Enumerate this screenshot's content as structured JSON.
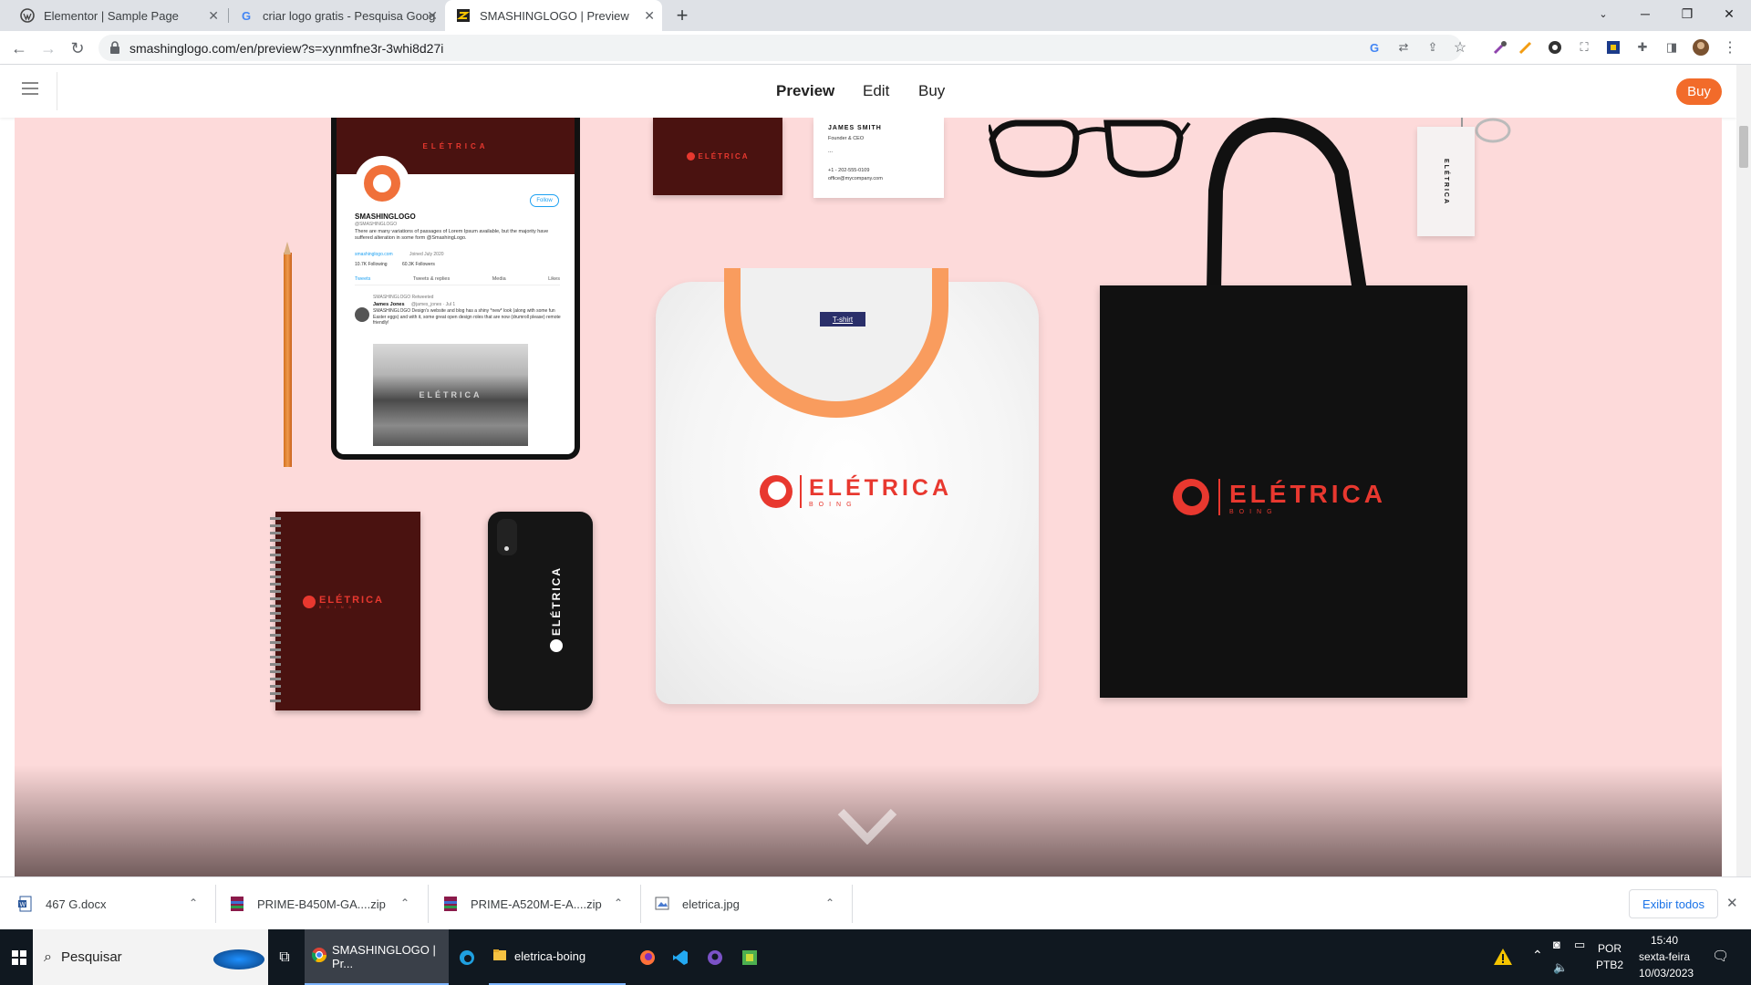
{
  "browser": {
    "tabs": [
      {
        "title": "Elementor | Sample Page",
        "active": false
      },
      {
        "title": "criar logo gratis - Pesquisa Goog",
        "active": false
      },
      {
        "title": "SMASHINGLOGO | Preview",
        "active": true
      }
    ],
    "new_tab": "+",
    "url": "smashinglogo.com/en/preview?s=xynmfne3r-3whi8d27i"
  },
  "site": {
    "nav": {
      "preview": "Preview",
      "edit": "Edit",
      "buy": "Buy"
    },
    "buy_button": "Buy"
  },
  "mockup": {
    "brand": "ELÉTRICA",
    "sub": "BOING",
    "tablet": {
      "account": "SMASHINGLOGO",
      "handle": "@SMASHINGLOGO",
      "follow": "Follow",
      "bio": "There are many variations of passages of Lorem Ipsum available, but the majority have suffered alteration in some form @SmashingLogo.",
      "link": "smashinglogo.com",
      "joined": "Joined July 2020",
      "following": "10.7K Following",
      "followers": "60.3K Followers",
      "tabs": [
        "Tweets",
        "Tweets & replies",
        "Media",
        "Likes"
      ],
      "retweet_label": "SMASHINGLOGO Retweeted",
      "tweet_author": "James Jones",
      "tweet_handle": "@james_jones · Jul 1",
      "tweet_text": "SMASHINGLOGO Design's website and blog has a shiny *new* look (along with some fun Easter eggs) and with it, some great open design roles that are now (drumroll please) remote friendly!"
    },
    "card": {
      "name": "JAMES SMITH",
      "title": "Founder & CEO",
      "dots": "...",
      "phone": "+1 - 202-555-0109",
      "email": "office@mycompany.com"
    },
    "shirt_tag": "T-shirt"
  },
  "downloads": {
    "items": [
      {
        "name": "467 G.docx",
        "type": "word"
      },
      {
        "name": "PRIME-B450M-GA....zip",
        "type": "rar"
      },
      {
        "name": "PRIME-A520M-E-A....zip",
        "type": "rar"
      },
      {
        "name": "eletrica.jpg",
        "type": "image"
      }
    ],
    "show_all": "Exibir todos"
  },
  "taskbar": {
    "search": "Pesquisar",
    "chrome_window": "SMASHINGLOGO | Pr...",
    "folder_window": "eletrica-boing",
    "lang": "POR",
    "layout": "PTB2",
    "time": "15:40",
    "day": "sexta-feira",
    "date": "10/03/2023"
  },
  "colors": {
    "brand": "#e8382f",
    "buy": "#f26b2a",
    "canvas": "#fddada",
    "burgundy": "#4a1210"
  }
}
